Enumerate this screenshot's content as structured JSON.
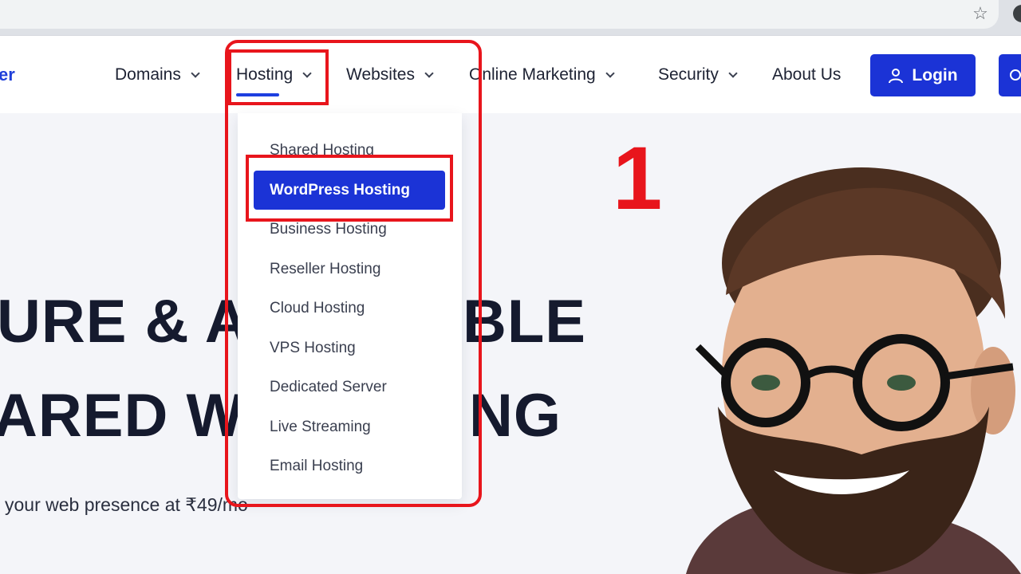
{
  "browser": {
    "star_icon": "star-icon"
  },
  "header": {
    "logo_fragment": "er",
    "nav": [
      {
        "label": "Domains",
        "has_dropdown": true
      },
      {
        "label": "Hosting",
        "has_dropdown": true,
        "active": true
      },
      {
        "label": "Websites",
        "has_dropdown": true
      },
      {
        "label": "Online Marketing",
        "has_dropdown": true
      },
      {
        "label": "Security",
        "has_dropdown": true
      },
      {
        "label": "About Us",
        "has_dropdown": false
      }
    ],
    "login_label": "Login",
    "login_icon": "user-icon",
    "accent_color": "#1b33d6"
  },
  "dropdown": {
    "items": [
      "Shared Hosting",
      "WordPress Hosting",
      "Business Hosting",
      "Reseller Hosting",
      "Cloud Hosting",
      "VPS Hosting",
      "Dedicated Server",
      "Live Streaming",
      "Email Hosting"
    ],
    "active_label": "WordPress Hosting"
  },
  "hero": {
    "line1": "URE & AF",
    "line1b": "BLE",
    "line2": "ARED WE",
    "line2b": "NG",
    "subtitle": "your web presence at ₹49/mo"
  },
  "annotation": {
    "step_number": "1",
    "color": "#e8151c"
  }
}
